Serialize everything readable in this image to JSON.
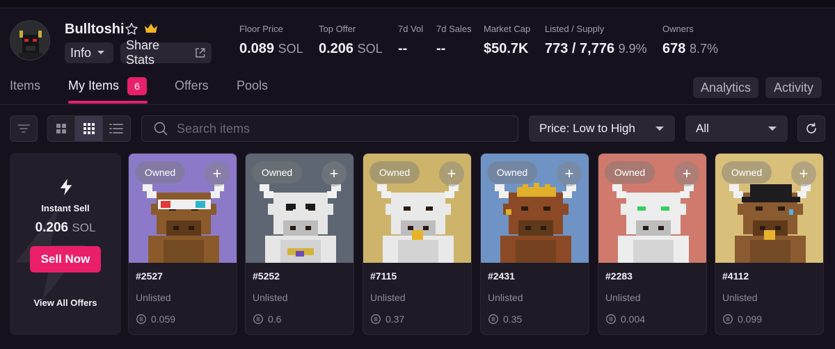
{
  "collection": {
    "name": "Bulltoshi",
    "buttons": {
      "info": "Info",
      "share": "Share Stats"
    }
  },
  "stats": [
    {
      "label": "Floor Price",
      "value": "0.089",
      "unit": "SOL"
    },
    {
      "label": "Top Offer",
      "value": "0.206",
      "unit": "SOL"
    },
    {
      "label": "7d Vol",
      "value": "--",
      "unit": ""
    },
    {
      "label": "7d Sales",
      "value": "--",
      "unit": ""
    },
    {
      "label": "Market Cap",
      "value": "$50.7K",
      "unit": ""
    },
    {
      "label": "Listed / Supply",
      "value": "773 / 7,776",
      "unit": "9.9%"
    },
    {
      "label": "Owners",
      "value": "678",
      "unit": "8.7%"
    }
  ],
  "tabs": [
    {
      "label": "Items"
    },
    {
      "label": "My Items",
      "badge": "6"
    },
    {
      "label": "Offers"
    },
    {
      "label": "Pools"
    }
  ],
  "right_buttons": {
    "analytics": "Analytics",
    "activity": "Activity"
  },
  "toolbar": {
    "search_placeholder": "Search items",
    "sort_value": "Price: Low to High",
    "filter_value": "All"
  },
  "instant_sell": {
    "title": "Instant Sell",
    "amount": "0.206",
    "unit": "SOL",
    "button": "Sell Now",
    "link": "View All Offers"
  },
  "cards": [
    {
      "id": "#2527",
      "status": "Unlisted",
      "price": "0.059",
      "badge": "Owned",
      "bg": "#8c7ac9"
    },
    {
      "id": "#5252",
      "status": "Unlisted",
      "price": "0.6",
      "badge": "Owned",
      "bg": "#5e6673"
    },
    {
      "id": "#7115",
      "status": "Unlisted",
      "price": "0.37",
      "badge": "Owned",
      "bg": "#cdb46a"
    },
    {
      "id": "#2431",
      "status": "Unlisted",
      "price": "0.35",
      "badge": "Owned",
      "bg": "#6f93c4"
    },
    {
      "id": "#2283",
      "status": "Unlisted",
      "price": "0.004",
      "badge": "Owned",
      "bg": "#cf7a6c"
    },
    {
      "id": "#4112",
      "status": "Unlisted",
      "price": "0.099",
      "badge": "Owned",
      "bg": "#d9c07a"
    }
  ],
  "colors": {
    "accent": "#e8206a",
    "background": "#15121d",
    "panel": "#24212d"
  }
}
